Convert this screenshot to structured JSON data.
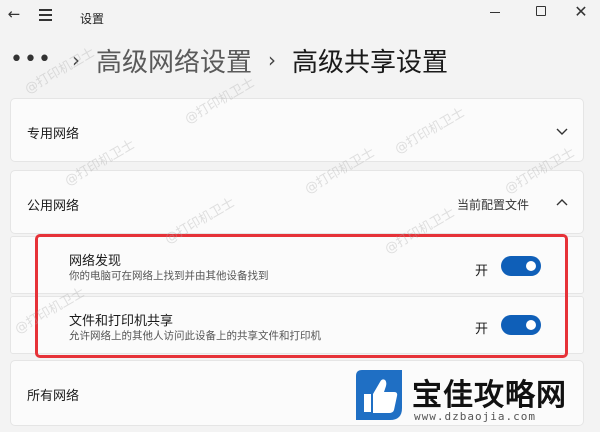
{
  "window": {
    "title": "设置",
    "back_glyph": "←",
    "close_glyph": "✕"
  },
  "breadcrumb": {
    "more": "•••",
    "items": [
      "高级网络设置",
      "高级共享设置"
    ],
    "separator": "›"
  },
  "sections": {
    "private": {
      "label": "专用网络",
      "expanded": false
    },
    "public": {
      "label": "公用网络",
      "note": "当前配置文件",
      "expanded": true,
      "settings": [
        {
          "title": "网络发现",
          "description": "你的电脑可在网络上找到并由其他设备找到",
          "state": "开",
          "on": true
        },
        {
          "title": "文件和打印机共享",
          "description": "允许网络上的其他人访问此设备上的共享文件和打印机",
          "state": "开",
          "on": true
        }
      ]
    },
    "all": {
      "label": "所有网络",
      "expanded": false
    }
  },
  "watermark": "@打印机卫士",
  "logo": {
    "text": "宝佳攻略网",
    "url": "www.dzbaojia.com"
  },
  "colors": {
    "toggle_on": "#0f5fb8",
    "highlight": "#e63238",
    "background": "#f3f3f3"
  }
}
